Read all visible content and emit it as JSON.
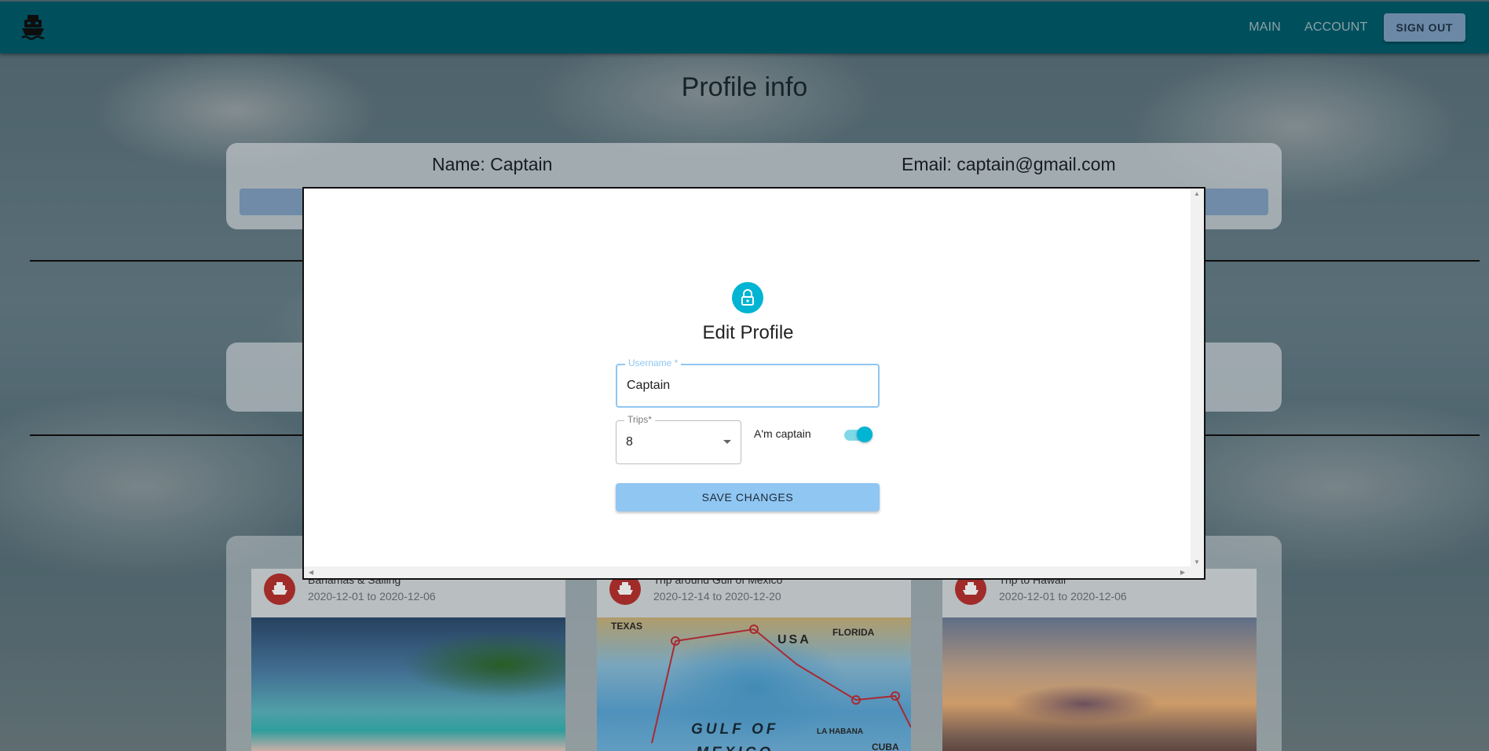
{
  "colors": {
    "appbar": "#005b6a",
    "accent": "#00b4d3",
    "save_button": "#90c6f2",
    "trip_avatar": "#b7322e"
  },
  "appbar": {
    "logo_icon": "ship-icon",
    "nav": {
      "main": "MAIN",
      "account": "ACCOUNT",
      "sign_out": "SIGN OUT"
    }
  },
  "page": {
    "title": "Profile info",
    "name_text": "Name: Captain",
    "email_text": "Email: captain@gmail.com"
  },
  "trips": [
    {
      "title": "Bahamas & Sailing",
      "dates": "2020-12-01 to 2020-12-06",
      "icon": "ship-icon"
    },
    {
      "title": "Trip around Gulf of Mexico",
      "dates": "2020-12-14 to 2020-12-20",
      "icon": "ship-icon"
    },
    {
      "title": "Trip to Hawaii",
      "dates": "2020-12-01 to 2020-12-06",
      "icon": "ship-icon"
    }
  ],
  "map_labels": {
    "gulf_line1": "GULF OF",
    "gulf_line2": "MEXICO",
    "usa": "USA",
    "texas": "TEXAS",
    "florida": "FLORIDA",
    "cuba": "CUBA",
    "habana": "LA HABANA"
  },
  "modal": {
    "icon": "lock-icon",
    "title": "Edit Profile",
    "username": {
      "label": "Username *",
      "value": "Captain"
    },
    "trips": {
      "label": "Trips*",
      "value": "8"
    },
    "captain_switch": {
      "label": "A'm captain",
      "checked": true
    },
    "save_label": "SAVE CHANGES"
  }
}
